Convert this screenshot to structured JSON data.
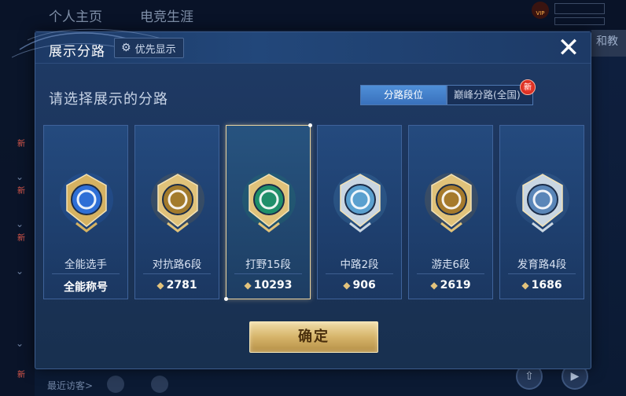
{
  "background": {
    "tabs": [
      "个人主页",
      "电竞生涯"
    ],
    "side_new_label": "新",
    "right_edge_text": "和教",
    "recent_visitors_label": "最近访客>",
    "vip_label": "VIP"
  },
  "dialog": {
    "title": "展示分路",
    "pref_button": "优先显示",
    "prompt": "请选择展示的分路",
    "segments": {
      "active": "分路段位",
      "inactive": "巅峰分路(全国)",
      "new_badge": "新"
    },
    "cards": [
      {
        "name": "全能选手",
        "stat": "全能称号",
        "icon": "all-round-emblem-icon",
        "colors": [
          "#2f6fd6",
          "#d5b262"
        ]
      },
      {
        "name": "对抗路6段",
        "stat": "2781",
        "icon": "clash-lane-emblem-icon",
        "colors": [
          "#a37b2c",
          "#e0c27a"
        ]
      },
      {
        "name": "打野15段",
        "stat": "10293",
        "icon": "jungle-emblem-icon",
        "colors": [
          "#1f8f6a",
          "#e0c27a"
        ],
        "selected": true
      },
      {
        "name": "中路2段",
        "stat": "906",
        "icon": "mid-lane-emblem-icon",
        "colors": [
          "#5aa0cf",
          "#c9d6e2"
        ]
      },
      {
        "name": "游走6段",
        "stat": "2619",
        "icon": "roam-emblem-icon",
        "colors": [
          "#a67a2c",
          "#e0c27a"
        ]
      },
      {
        "name": "发育路4段",
        "stat": "1686",
        "icon": "farm-lane-emblem-icon",
        "colors": [
          "#5a86b8",
          "#c9d6e2"
        ]
      }
    ],
    "confirm_button": "确定"
  }
}
